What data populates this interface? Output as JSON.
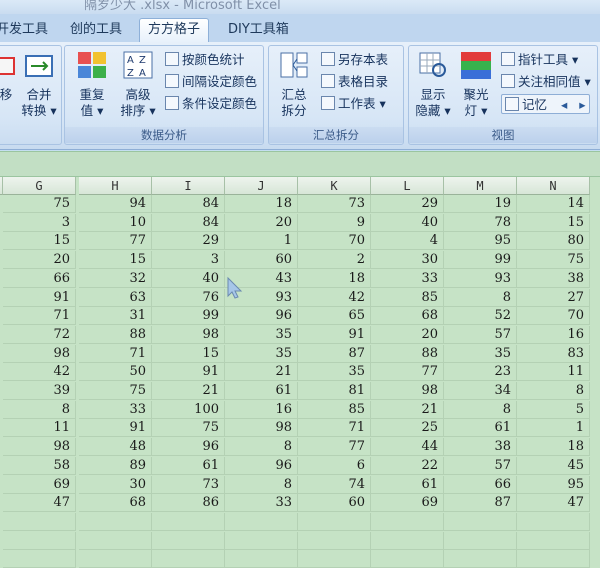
{
  "title": "隔岁少大 .xlsx - Microsoft Excel",
  "tabs": [
    {
      "label": "开发工具"
    },
    {
      "label": "创的工具"
    },
    {
      "label": "方方格子"
    },
    {
      "label": "DIY工具箱"
    }
  ],
  "ribbon": {
    "group0": {
      "btn_a": "移",
      "btn_b": "合并",
      "btn_a2": "转换 ▾"
    },
    "analysis": {
      "label": "数据分析",
      "repeat_l1": "重复",
      "repeat_l2": "值 ▾",
      "sort_l1": "高级",
      "sort_l2": "排序 ▾",
      "color_stats": "按颜色统计",
      "interval_color": "间隔设定颜色",
      "cond_color": "条件设定颜色"
    },
    "summary": {
      "label": "汇总拆分",
      "split_l1": "汇总",
      "split_l2": "拆分",
      "save_sheet": "另存本表",
      "sheet_dir": "表格目录",
      "worksheet": "工作表 ▾"
    },
    "view": {
      "label": "视图",
      "show_l1": "显示",
      "show_l2": "隐藏 ▾",
      "glow_l1": "聚光",
      "glow_l2": "灯 ▾",
      "pointer_tool": "指针工具 ▾",
      "focus_same": "关注相同值 ▾",
      "memory": "记忆"
    }
  },
  "columns": [
    "G",
    "H",
    "I",
    "J",
    "K",
    "L",
    "M",
    "N"
  ],
  "rows": [
    [
      "75",
      "94",
      "84",
      "18",
      "73",
      "29",
      "19",
      "14"
    ],
    [
      "3",
      "10",
      "84",
      "20",
      "9",
      "40",
      "78",
      "15"
    ],
    [
      "15",
      "77",
      "29",
      "1",
      "70",
      "4",
      "95",
      "80"
    ],
    [
      "20",
      "15",
      "3",
      "60",
      "2",
      "30",
      "99",
      "75"
    ],
    [
      "66",
      "32",
      "40",
      "43",
      "18",
      "33",
      "93",
      "38"
    ],
    [
      "91",
      "63",
      "76",
      "93",
      "42",
      "85",
      "8",
      "27"
    ],
    [
      "71",
      "31",
      "99",
      "96",
      "65",
      "68",
      "52",
      "70"
    ],
    [
      "72",
      "88",
      "98",
      "35",
      "91",
      "20",
      "57",
      "16"
    ],
    [
      "98",
      "71",
      "15",
      "35",
      "87",
      "88",
      "35",
      "83"
    ],
    [
      "42",
      "50",
      "91",
      "21",
      "35",
      "77",
      "23",
      "11"
    ],
    [
      "39",
      "75",
      "21",
      "61",
      "81",
      "98",
      "34",
      "8"
    ],
    [
      "8",
      "33",
      "100",
      "16",
      "85",
      "21",
      "8",
      "5"
    ],
    [
      "11",
      "91",
      "75",
      "98",
      "71",
      "25",
      "61",
      "1"
    ],
    [
      "98",
      "48",
      "96",
      "8",
      "77",
      "44",
      "38",
      "18"
    ],
    [
      "58",
      "89",
      "61",
      "96",
      "6",
      "22",
      "57",
      "45"
    ],
    [
      "69",
      "30",
      "73",
      "8",
      "74",
      "61",
      "66",
      "95"
    ],
    [
      "47",
      "68",
      "86",
      "33",
      "60",
      "69",
      "87",
      "47"
    ]
  ],
  "colors": {
    "sheet_bg": "#c6e3c6",
    "ribbon_bg": "#dce9f7",
    "active_tab": "#ffffff"
  }
}
